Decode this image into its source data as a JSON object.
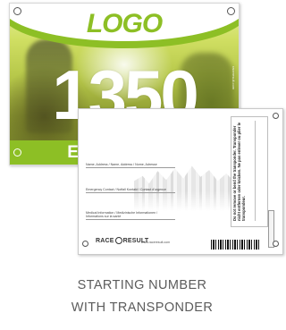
{
  "front": {
    "logo": "LOGO",
    "number": "1350",
    "event_name": "EVENT NAME",
    "side_text": "raceresult.com",
    "accent_color": "#8dbf25"
  },
  "back": {
    "fields": [
      "Name, Address / Name, Address / Nome, Adresse",
      "Emergency Contact / Notfall Kontakt / Contact d'urgence",
      "Medical Information / Medizinische Informationen / Informations sur la santé"
    ],
    "vertical_text": "Do not remove or bend the transponder. Transponder nicht entfernen oder knicken. Ne pas enlever ou plier le transpondeur.",
    "brand": {
      "left": "RACE",
      "right": "RESULT"
    },
    "url": "www.raceresult.com"
  },
  "caption": {
    "line1": "STARTING NUMBER",
    "line2": "WITH TRANSPONDER"
  }
}
